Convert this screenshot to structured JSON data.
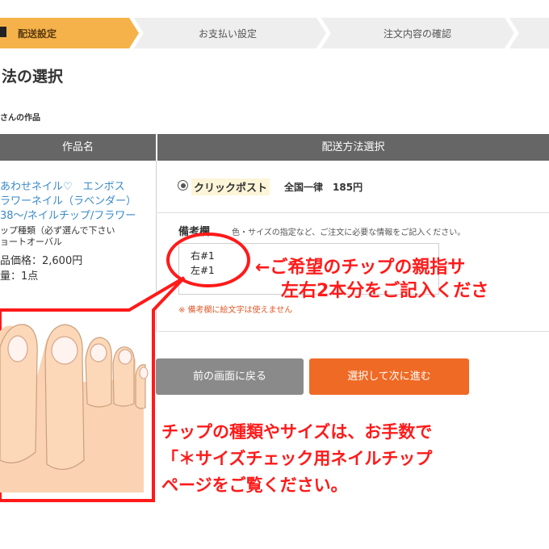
{
  "steps": [
    {
      "label": "配送設定",
      "active": true
    },
    {
      "label": "お支払い設定",
      "active": false
    },
    {
      "label": "注文内容の確認",
      "active": false
    }
  ],
  "page_title": "法の選択",
  "creator_line": "さんの作品",
  "table": {
    "col_item": "作品名",
    "col_shipping": "配送方法選択"
  },
  "item": {
    "name_lines": [
      "あわせネイル♡　エンボス",
      "ラワーネイル（ラベンダー）",
      "38～/ネイルチップ/フラワー"
    ],
    "option_lines": [
      "ップ種類（必ず選んで下さい",
      "ョートオーバル"
    ],
    "price": "品価格：2,600円",
    "quantity": "量：1点"
  },
  "shipping": {
    "method": "クリックポスト",
    "region": "全国一律",
    "price": "185円",
    "selected": true
  },
  "notes": {
    "label": "備考欄",
    "hint": "色・サイズの指定など、ご注文に必要な情報をご記入ください。",
    "lines": [
      "右#1",
      "左#1"
    ],
    "warning": "※ 備考欄に絵文字は使えません"
  },
  "buttons": {
    "back": "前の画面に戻る",
    "next": "選択して次に進む"
  },
  "callouts": {
    "arrow_lines": [
      "←ご希望のチップの親指サ",
      "左右2本分をご記入くださ"
    ],
    "bottom_lines": [
      "チップの種類やサイズは、お手数で",
      "「＊サイズチェック用ネイルチップ",
      "ページをご覧ください。"
    ]
  },
  "colors": {
    "active_step": "#f5b24a",
    "inactive_step": "#eeeeee",
    "header": "#666666",
    "link": "#3a8ac8",
    "next_button": "#ef6a25",
    "back_button": "#8a8a8a",
    "callout": "#ff1a1a",
    "skin": "#fbd3b2"
  }
}
